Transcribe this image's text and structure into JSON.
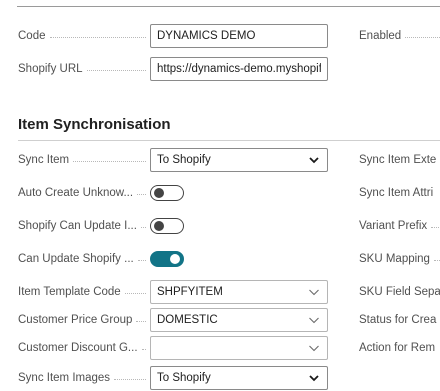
{
  "general": {
    "code_label": "Code",
    "code_value": "DYNAMICS DEMO",
    "enabled_label": "Enabled",
    "url_label": "Shopify URL",
    "url_value": "https://dynamics-demo.myshopify.com"
  },
  "item_sync": {
    "title": "Item Synchronisation",
    "fields": [
      {
        "label": "Sync Item",
        "value": "To Shopify",
        "right_label": "Sync Item Exte"
      },
      {
        "label": "Auto Create Unknow...",
        "toggle": false,
        "right_label": "Sync Item Attri"
      },
      {
        "label": "Shopify Can Update I...",
        "toggle": false,
        "right_label": "Variant Prefix"
      },
      {
        "label": "Can Update Shopify ...",
        "toggle": true,
        "right_label": "SKU Mapping"
      },
      {
        "label": "Item Template Code",
        "value": "SHPFYITEM",
        "right_label": "SKU Field Sepa"
      },
      {
        "label": "Customer Price Group",
        "value": "DOMESTIC",
        "right_label": "Status for Crea"
      },
      {
        "label": "Customer Discount G...",
        "value": "",
        "right_label": "Action for Rem"
      },
      {
        "label": "Sync Item Images",
        "value": "To Shopify"
      }
    ]
  },
  "colors": {
    "toggle_on": "#127487",
    "field_border": "#8a8a8a",
    "label_text": "#505050"
  }
}
